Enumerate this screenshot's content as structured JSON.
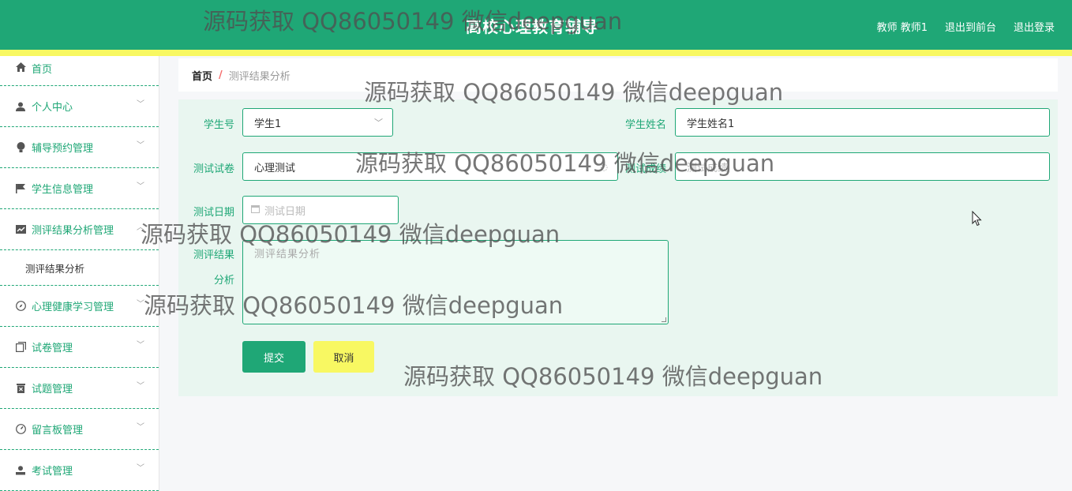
{
  "header": {
    "title": "高校心理教育辅导",
    "user": "教师 教师1",
    "to_front": "退出到前台",
    "logout": "退出登录"
  },
  "sidebar": {
    "items": [
      {
        "label": "首页",
        "icon": "home-icon"
      },
      {
        "label": "个人中心",
        "icon": "user-icon"
      },
      {
        "label": "辅导预约管理",
        "icon": "bulb-icon"
      },
      {
        "label": "学生信息管理",
        "icon": "flag-icon"
      },
      {
        "label": "测评结果分析管理",
        "icon": "chart-icon"
      },
      {
        "label": "心理健康学习管理",
        "icon": "compass-icon"
      },
      {
        "label": "试卷管理",
        "icon": "copy-icon"
      },
      {
        "label": "试题管理",
        "icon": "trash-icon"
      },
      {
        "label": "留言板管理",
        "icon": "gauge-icon"
      },
      {
        "label": "考试管理",
        "icon": "person-icon"
      }
    ],
    "sub_item": "测评结果分析"
  },
  "breadcrumb": {
    "home": "首页",
    "separator": "/",
    "current": "测评结果分析"
  },
  "form": {
    "student_no_label": "学生号",
    "student_no_value": "学生1",
    "student_name_label": "学生姓名",
    "student_name_value": "学生姓名1",
    "paper_label": "测试试卷",
    "paper_value": "心理测试",
    "score_label": "测试成绩",
    "score_placeholder": "测试成绩",
    "date_label": "测试日期",
    "date_placeholder": "测试日期",
    "result_label_1": "测评结果",
    "result_label_2": "分析",
    "result_placeholder": "测评结果分析",
    "submit": "提交",
    "cancel": "取消"
  },
  "watermark": "源码获取 QQ86050149 微信deepguan",
  "colors": {
    "primary": "#1fa776",
    "accent_yellow": "#f8f862",
    "panel_bg": "#e9f6f0"
  }
}
